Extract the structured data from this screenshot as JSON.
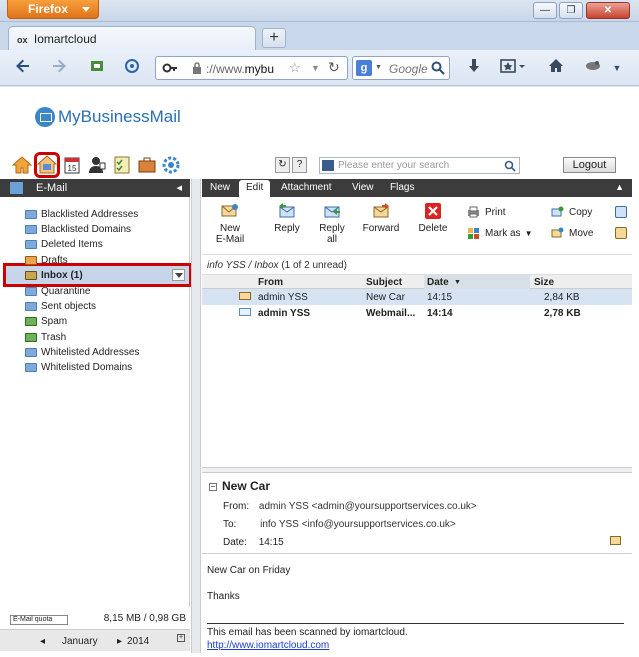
{
  "browser": {
    "app_button": "Firefox",
    "tab_title": "Iomartcloud",
    "tab_prefix": "ox",
    "url_text": "://www.",
    "url_domain": "mybu",
    "search_placeholder": "Google",
    "search_engine": "g"
  },
  "app": {
    "logo_text": "MyBusinessMail",
    "search_placeholder": "Please enter your search",
    "logout": "Logout"
  },
  "left": {
    "header": "E-Mail",
    "folders": [
      "Blacklisted Addresses",
      "Blacklisted Domains",
      "Deleted Items",
      "Drafts",
      "Inbox (1)",
      "Quarantine",
      "Sent objects",
      "Spam",
      "Trash",
      "Whitelisted Addresses",
      "Whitelisted Domains"
    ],
    "quota_label": "E-Mail quota",
    "quota_value": "8,15 MB / 0,98 GB",
    "cal_month": "January",
    "cal_year": "2014"
  },
  "mail_tabs": [
    "New",
    "Edit",
    "Attachment",
    "View",
    "Flags"
  ],
  "toolbar": {
    "new_line1": "New",
    "new_line2": "E-Mail",
    "reply": "Reply",
    "reply_all_line1": "Reply",
    "reply_all_line2": "all",
    "forward": "Forward",
    "delete": "Delete",
    "print": "Print",
    "mark_as": "Mark as",
    "copy": "Copy",
    "move": "Move"
  },
  "path": {
    "account": "info YSS",
    "sep": " / ",
    "folder": "Inbox",
    "count": " (1 of 2 unread)"
  },
  "grid": {
    "columns": [
      "From",
      "Subject",
      "Date",
      "Size"
    ],
    "rows": [
      {
        "from": "admin YSS",
        "subject": "New Car",
        "date": "14:15",
        "size": "2,84 KB"
      },
      {
        "from": "admin YSS",
        "subject": "Webmail...",
        "date": "14:14",
        "size": "2,78 KB"
      }
    ]
  },
  "preview": {
    "subject": "New Car",
    "from_label": "From:",
    "from_value": "admin YSS <admin@yoursupportservices.co.uk>",
    "to_label": "To:",
    "to_value": "info YSS <info@yoursupportservices.co.uk>",
    "date_label": "Date:",
    "date_value": "14:15",
    "body_line1": "New Car on Friday",
    "body_line2": "Thanks",
    "scan_text": "This email has been scanned by iomartcloud.",
    "scan_link": "http://www.iomartcloud.com"
  }
}
